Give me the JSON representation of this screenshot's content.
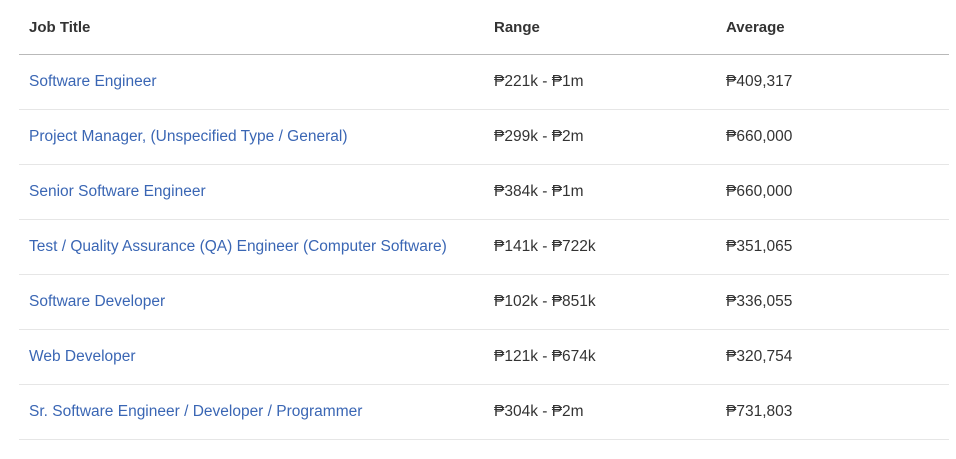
{
  "table": {
    "headers": {
      "job_title": "Job Title",
      "range": "Range",
      "average": "Average"
    },
    "rows": [
      {
        "title": "Software Engineer",
        "range": "₱221k - ₱1m",
        "average": "₱409,317"
      },
      {
        "title": "Project Manager, (Unspecified Type / General)",
        "range": "₱299k - ₱2m",
        "average": "₱660,000"
      },
      {
        "title": "Senior Software Engineer",
        "range": "₱384k - ₱1m",
        "average": "₱660,000"
      },
      {
        "title": "Test / Quality Assurance (QA) Engineer (Computer Software)",
        "range": "₱141k - ₱722k",
        "average": "₱351,065"
      },
      {
        "title": "Software Developer",
        "range": "₱102k - ₱851k",
        "average": "₱336,055"
      },
      {
        "title": "Web Developer",
        "range": "₱121k - ₱674k",
        "average": "₱320,754"
      },
      {
        "title": "Sr. Software Engineer / Developer / Programmer",
        "range": "₱304k - ₱2m",
        "average": "₱731,803"
      }
    ]
  },
  "colors": {
    "link": "#3a66b4",
    "text": "#333333",
    "header_border": "#b9b9b9",
    "row_border": "#e6e6e6"
  }
}
